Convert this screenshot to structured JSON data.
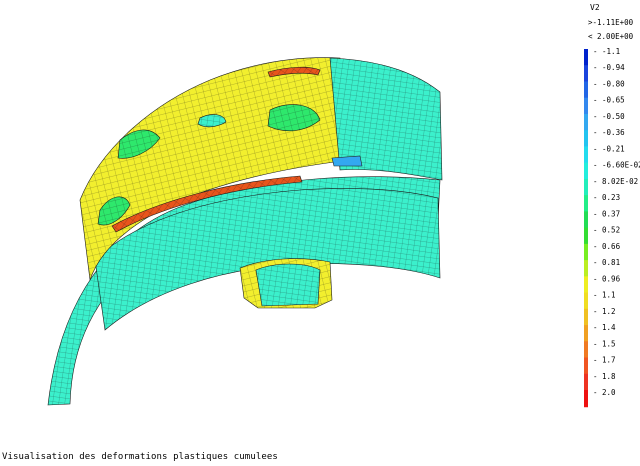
{
  "legend": {
    "variable": "V2",
    "max_label": ">-1.11E+00",
    "min_label": "< 2.00E+00",
    "levels": [
      {
        "label": "-1.1",
        "color": "#0022cc"
      },
      {
        "label": "-0.94",
        "color": "#1a44dd"
      },
      {
        "label": "-0.80",
        "color": "#2266e6"
      },
      {
        "label": "-0.65",
        "color": "#3388ee"
      },
      {
        "label": "-0.50",
        "color": "#33a8f0"
      },
      {
        "label": "-0.36",
        "color": "#22c4f0"
      },
      {
        "label": "-0.21",
        "color": "#22dcee"
      },
      {
        "label": "-6.60E-02",
        "color": "#22eedd"
      },
      {
        "label": "8.02E-02",
        "color": "#22eebb"
      },
      {
        "label": "0.23",
        "color": "#22ee88"
      },
      {
        "label": "0.37",
        "color": "#22dd55"
      },
      {
        "label": "0.52",
        "color": "#33dd33"
      },
      {
        "label": "0.66",
        "color": "#77ee22"
      },
      {
        "label": "0.81",
        "color": "#bbee22"
      },
      {
        "label": "0.96",
        "color": "#eeee22"
      },
      {
        "label": "1.1",
        "color": "#f0dd22"
      },
      {
        "label": "1.2",
        "color": "#f0c022"
      },
      {
        "label": "1.4",
        "color": "#f0a022"
      },
      {
        "label": "1.5",
        "color": "#f07a22"
      },
      {
        "label": "1.7",
        "color": "#f05522"
      },
      {
        "label": "1.8",
        "color": "#ee3322"
      },
      {
        "label": "2.0",
        "color": "#ee1111"
      }
    ]
  },
  "caption": "Visualisation des deformations plastiques cumulees",
  "colors": {
    "mesh_base": "#3bf0cc",
    "mesh_high": "#f2ef2e",
    "mesh_mid": "#2ee86c",
    "mesh_peak": "#e8551c",
    "grid_line": "#1a1a1a"
  }
}
